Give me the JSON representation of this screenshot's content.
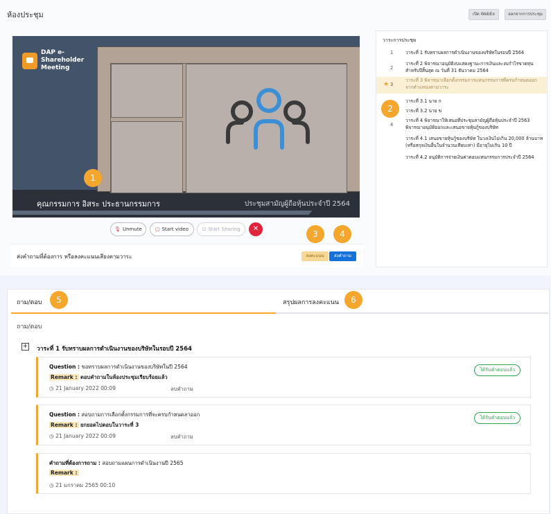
{
  "header": {
    "title": "ห้องประชุม",
    "open_webex": "เปิด WebEx",
    "leave_meeting": "ออกจากการประชุม"
  },
  "video": {
    "logo_text": "DAP e-Shareholder Meeting",
    "caption_left": "คุณกรรมการ อิสระ ประธานกรรมการ",
    "caption_right": "ประชุมสามัญผู้ถือหุ้นประจำปี 2564"
  },
  "controls": {
    "unmute": "Unmute",
    "start_video": "Start video",
    "start_sharing": "Start Sharing"
  },
  "send_bar": {
    "label": "ส่งคำถามที่ต้องการ หรือลงคะแนนเสียงตามวาระ",
    "vote": "ลงคะแนน",
    "ask": "ส่งคำถาม"
  },
  "agenda": {
    "title": "วาระการประชุม",
    "items": [
      {
        "num": "1",
        "text": "วาระที่ 1 รับทราบผลการดำเนินงานของบริษัทในรอบปี 2564"
      },
      {
        "num": "2",
        "text": "วาระที่ 2 พิจารณาอนุมัติงบแสดงฐานะการเงินและงบกำไรขาดทุนสำหรับปีสิ้นสุด ณ วันที่ 31 ธันวาคม 2564"
      },
      {
        "num": "3",
        "text": "วาระที่ 3 พิจารณาเลือกตั้งกรรมการแทนกรรมการที่ครบกำหนดออกจากตำแหน่งตามวาระ"
      },
      {
        "num": "",
        "text": "วาระที่ 3.1 นาย ก"
      },
      {
        "num": "",
        "text": "วาระที่ 3.2 นาย ข"
      },
      {
        "num": "4",
        "text": "วาระที่ 4 พิจารณาให้เสนอที่ประชุมสามัญผู้ถือหุ้นประจำปี 2563 พิจารณาอนุมัติออกและเสนอขายหุ้นกู้ของบริษัท"
      },
      {
        "num": "",
        "text": "วาระที่ 4.1 เสนอขายหุ้นกู้ของบริษัท ในวงเงินไม่เกิน 20,000 ล้านบาท (หรือสกุลเงินอื่นในจำนวนเทียบเท่า) มีอายุไม่เกิน 10 ปี"
      },
      {
        "num": "",
        "text": "วาระที่ 4.2 อนุมัติการจ่ายเงินค่าตอบแทนกรรมการประจำปี 2564"
      }
    ]
  },
  "callouts": [
    "1",
    "2",
    "3",
    "4",
    "5",
    "6"
  ],
  "tabs": {
    "qa": "ถาม/ตอบ",
    "summary": "สรุปผลการลงคะแนน"
  },
  "qa": {
    "subtitle": "ถาม/ตอบ",
    "group_toggle": "+",
    "group_title": "วาระที่ 1 รับทราบผลการดำเนินงานของบริษัทในรอบปี 2564",
    "question_label": "Question :",
    "remark_label": "Remark :",
    "required_label": "คำถามที่ต้องการถาม :",
    "delete_label": "ลบคำถาม",
    "answered_label": "ได้รับคำตอบแล้ว",
    "cards": [
      {
        "question": "ขอทราบผลการดำเนินงานของบริษัทในปี 2564",
        "remark": "ตอบคำถามในห้องประชุมเรียบร้อยแล้ว",
        "date": "21 January 2022 00:09"
      },
      {
        "question": "สอบถามการเลือกตั้งกรรมการที่จะครบกำหนดลาออก",
        "remark": "ยกยอดไปตอบในวาระที่ 3",
        "date": "21 January 2022 00:09"
      },
      {
        "question": "สอบถามแผนการดำเนินงานปี 2565",
        "remark": "",
        "date": "21 มกราคม 2565 00:10"
      }
    ]
  }
}
